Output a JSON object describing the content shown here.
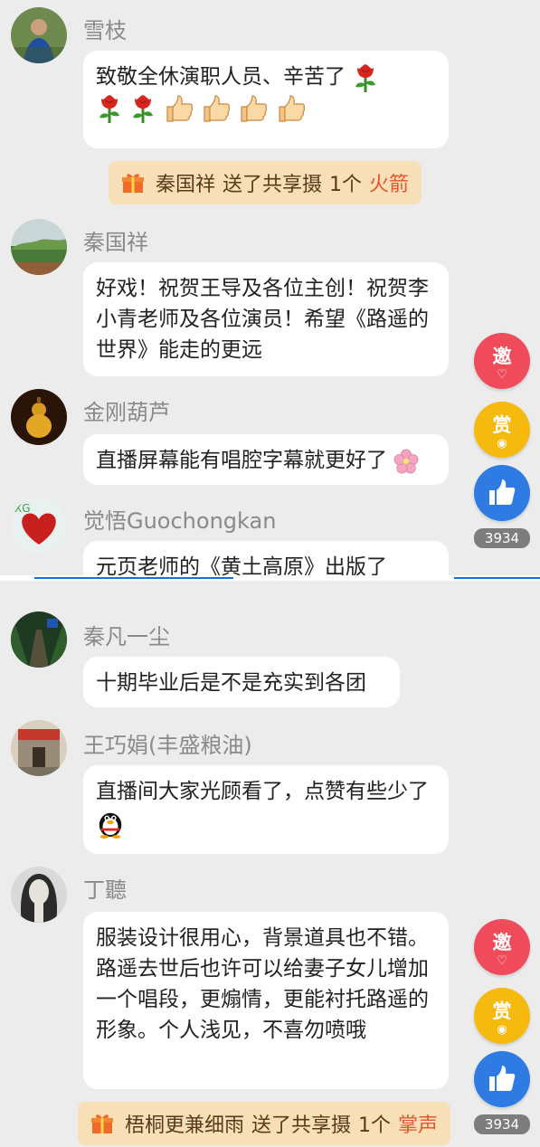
{
  "top_feed": {
    "messages": [
      {
        "user": "雪枝",
        "text": "致敬全休演职人员、辛苦了",
        "emoji": [
          "rose",
          "rose",
          "rose",
          "thumbs-up",
          "thumbs-up",
          "thumbs-up",
          "thumbs-up"
        ]
      },
      {
        "user": "秦国祥",
        "text": "好戏！祝贺王导及各位主创！祝贺李小青老师及各位演员！希望《路遥的世界》能走的更远"
      },
      {
        "user": "金刚葫芦",
        "text": "直播屏幕能有唱腔字幕就更好了",
        "emoji": [
          "cherry-blossom"
        ]
      },
      {
        "user": "觉悟Guochongkan",
        "text": "元页老师的《黄土高原》出版了"
      }
    ],
    "gift": {
      "sender": "秦国祥",
      "action": "送了共享摄",
      "count": "1个",
      "gift_name": "火箭"
    },
    "side_buttons": {
      "invite_label": "邀",
      "reward_label": "赏",
      "like_count": "3934"
    }
  },
  "bottom_feed": {
    "messages": [
      {
        "user": "秦凡一尘",
        "text": "十期毕业后是不是充实到各团"
      },
      {
        "user": "王巧娟(丰盛粮油)",
        "text": "直播间大家光顾看了，点赞有些少了",
        "emoji": [
          "penguin"
        ]
      },
      {
        "user": "丁聽",
        "text": "服装设计很用心，背景道具也不错。路遥去世后也许可以给妻子女儿增加一个唱段，更煽情，更能衬托路遥的形象。个人浅见，不喜勿喷哦"
      }
    ],
    "gift": {
      "sender": "梧桐更兼细雨",
      "action": "送了共享摄",
      "count": "1个",
      "gift_name": "掌声"
    },
    "side_buttons": {
      "invite_label": "邀",
      "reward_label": "赏",
      "like_count": "3934"
    }
  },
  "colors": {
    "background": "#ececec",
    "bubble": "#ffffff",
    "gift_bg": "#f7dfb8",
    "gift_name": "#e8542f",
    "invite": "#ef4b5b",
    "reward": "#f6b90e",
    "like": "#2e7be3",
    "divider": "#1e6ddc"
  }
}
